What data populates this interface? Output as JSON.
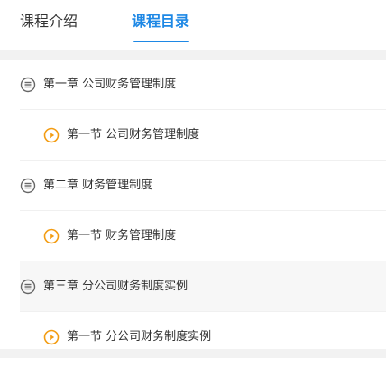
{
  "tabs": [
    {
      "label": "课程介绍",
      "active": false
    },
    {
      "label": "课程目录",
      "active": true
    }
  ],
  "colors": {
    "accent": "#1e88e5",
    "play_icon": "#f39c12",
    "chapter_icon": "#666666"
  },
  "catalog": {
    "items": [
      {
        "type": "chapter",
        "label": "第一章 公司财务管理制度",
        "icon": "list-circle-icon"
      },
      {
        "type": "section",
        "label": "第一节 公司财务管理制度",
        "icon": "play-circle-icon"
      },
      {
        "type": "chapter",
        "label": "第二章 财务管理制度",
        "icon": "list-circle-icon"
      },
      {
        "type": "section",
        "label": "第一节 财务管理制度",
        "icon": "play-circle-icon"
      },
      {
        "type": "chapter",
        "label": "第三章 分公司财务制度实例",
        "icon": "list-circle-icon",
        "highlighted": true
      },
      {
        "type": "section",
        "label": "第一节 分公司财务制度实例",
        "icon": "play-circle-icon"
      }
    ]
  }
}
